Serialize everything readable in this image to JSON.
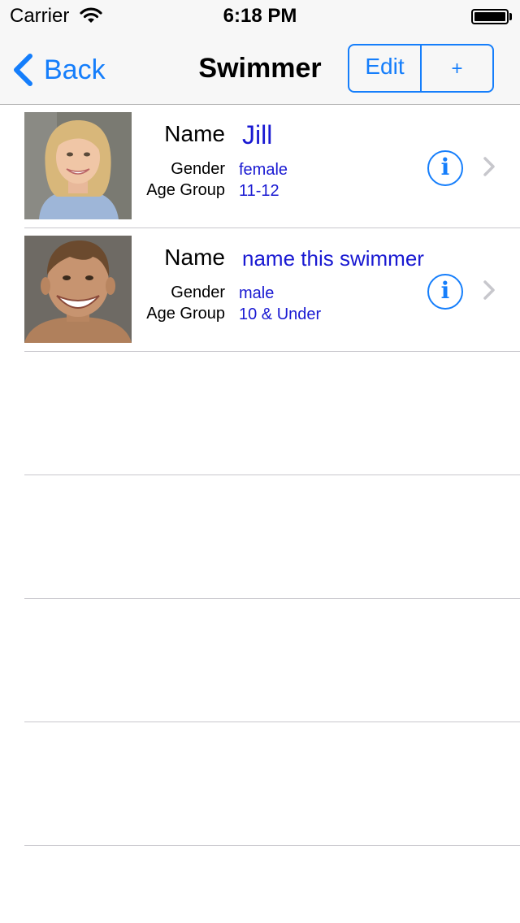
{
  "status_bar": {
    "carrier": "Carrier",
    "time": "6:18 PM"
  },
  "nav": {
    "back_label": "Back",
    "title": "Swimmer",
    "edit_label": "Edit",
    "add_label": "+"
  },
  "labels": {
    "name": "Name",
    "gender": "Gender",
    "age_group": "Age Group"
  },
  "swimmers": [
    {
      "name": "Jill",
      "gender": "female",
      "age_group": "11-12"
    },
    {
      "name": "name this swimmer",
      "gender": "male",
      "age_group": "10 & Under"
    }
  ],
  "colors": {
    "accent": "#157efb",
    "value_text": "#1919d2",
    "separator": "#c8c7cc"
  },
  "icons": {
    "back": "chevron-left-icon",
    "info": "info-circle-icon",
    "disclosure": "chevron-right-icon"
  }
}
